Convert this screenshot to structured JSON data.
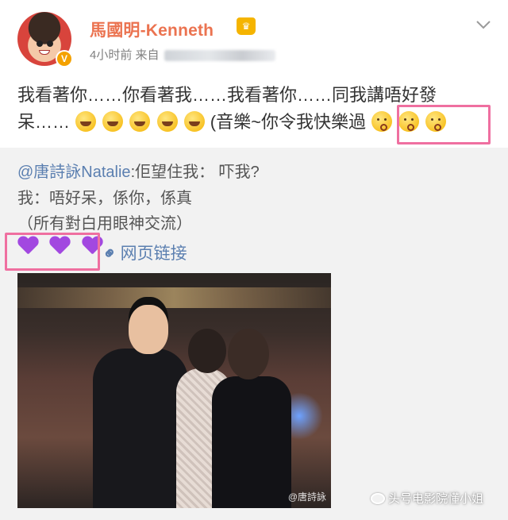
{
  "header": {
    "username": "馬國明-Kenneth",
    "time": "4小时前",
    "source_prefix": "来自",
    "verified_badge": "V",
    "vip_badge": "♛"
  },
  "post": {
    "line1": "我看著你……你看著我……我看著你……同我講唔好發",
    "line2_prefix": "呆……",
    "line2_mid": "(音樂~你令我快樂過",
    "icons": {
      "laugh": "rolling-laugh-emoji",
      "kiss": "kissing-emoji"
    }
  },
  "repost": {
    "mention": "@唐詩詠Natalie",
    "line1_rest": ":佢望住我： 吓我?",
    "line2": "我：唔好呆，係你，係真",
    "line3": "（所有對白用眼神交流）",
    "link_icon": "⚭",
    "link_label": "网页链接",
    "hearts_color": "#a248e0"
  },
  "photo": {
    "credit": "@唐詩詠"
  },
  "watermark": {
    "text": "头号电影院懂小姐"
  },
  "colors": {
    "username": "#eb7350",
    "link": "#5b7fb0",
    "highlight": "#ef6fa0"
  }
}
